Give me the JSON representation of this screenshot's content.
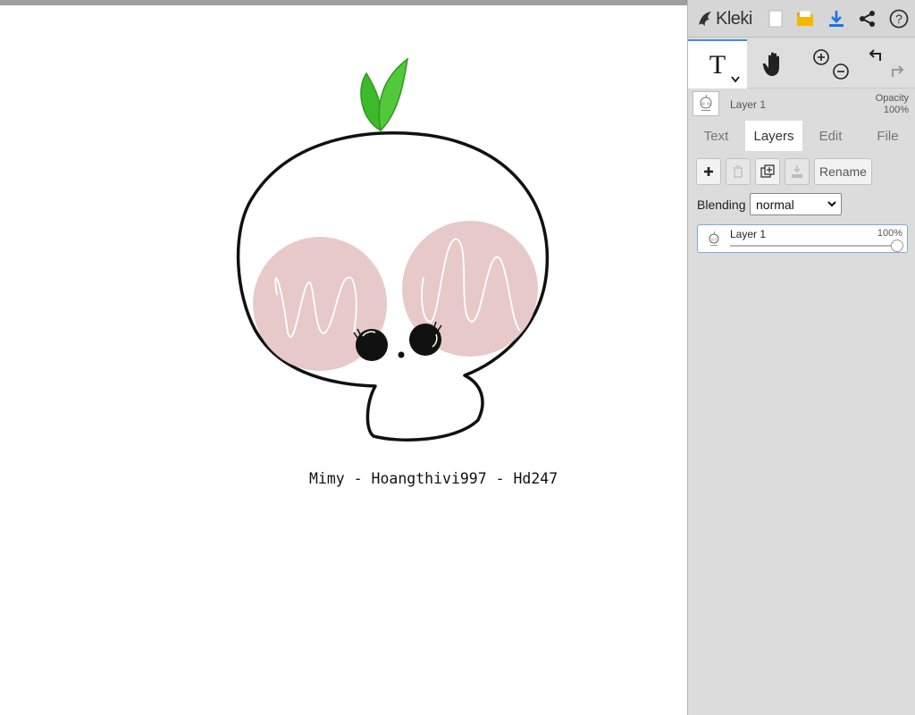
{
  "app": {
    "name": "Kleki"
  },
  "canvas": {
    "signature": "Mimy - Hoangthivi997 - Hd247"
  },
  "top_bar": {
    "icons": [
      "new-file-icon",
      "open-folder-icon",
      "download-icon",
      "share-icon",
      "help-icon"
    ]
  },
  "toolbar": {
    "text_tool_glyph": "T",
    "tools": [
      "text-tool",
      "hand-tool",
      "zoom-in",
      "zoom-out",
      "undo",
      "redo"
    ]
  },
  "layer_info": {
    "name": "Layer 1",
    "opacity_label": "Opacity",
    "opacity_value": "100%"
  },
  "tabs": [
    {
      "label": "Text",
      "active": false
    },
    {
      "label": "Layers",
      "active": true
    },
    {
      "label": "Edit",
      "active": false
    },
    {
      "label": "File",
      "active": false
    }
  ],
  "layers_panel": {
    "rename_label": "Rename",
    "blending_label": "Blending",
    "blending_value": "normal",
    "layers": [
      {
        "name": "Layer 1",
        "opacity": "100%"
      }
    ]
  },
  "colors": {
    "accent": "#4a8ad9",
    "panel_bg": "#dcdcdc",
    "cheek": "#e8c9c9",
    "sprout": "#3dba2a",
    "folder": "#f5b800",
    "download": "#1a73e8"
  }
}
